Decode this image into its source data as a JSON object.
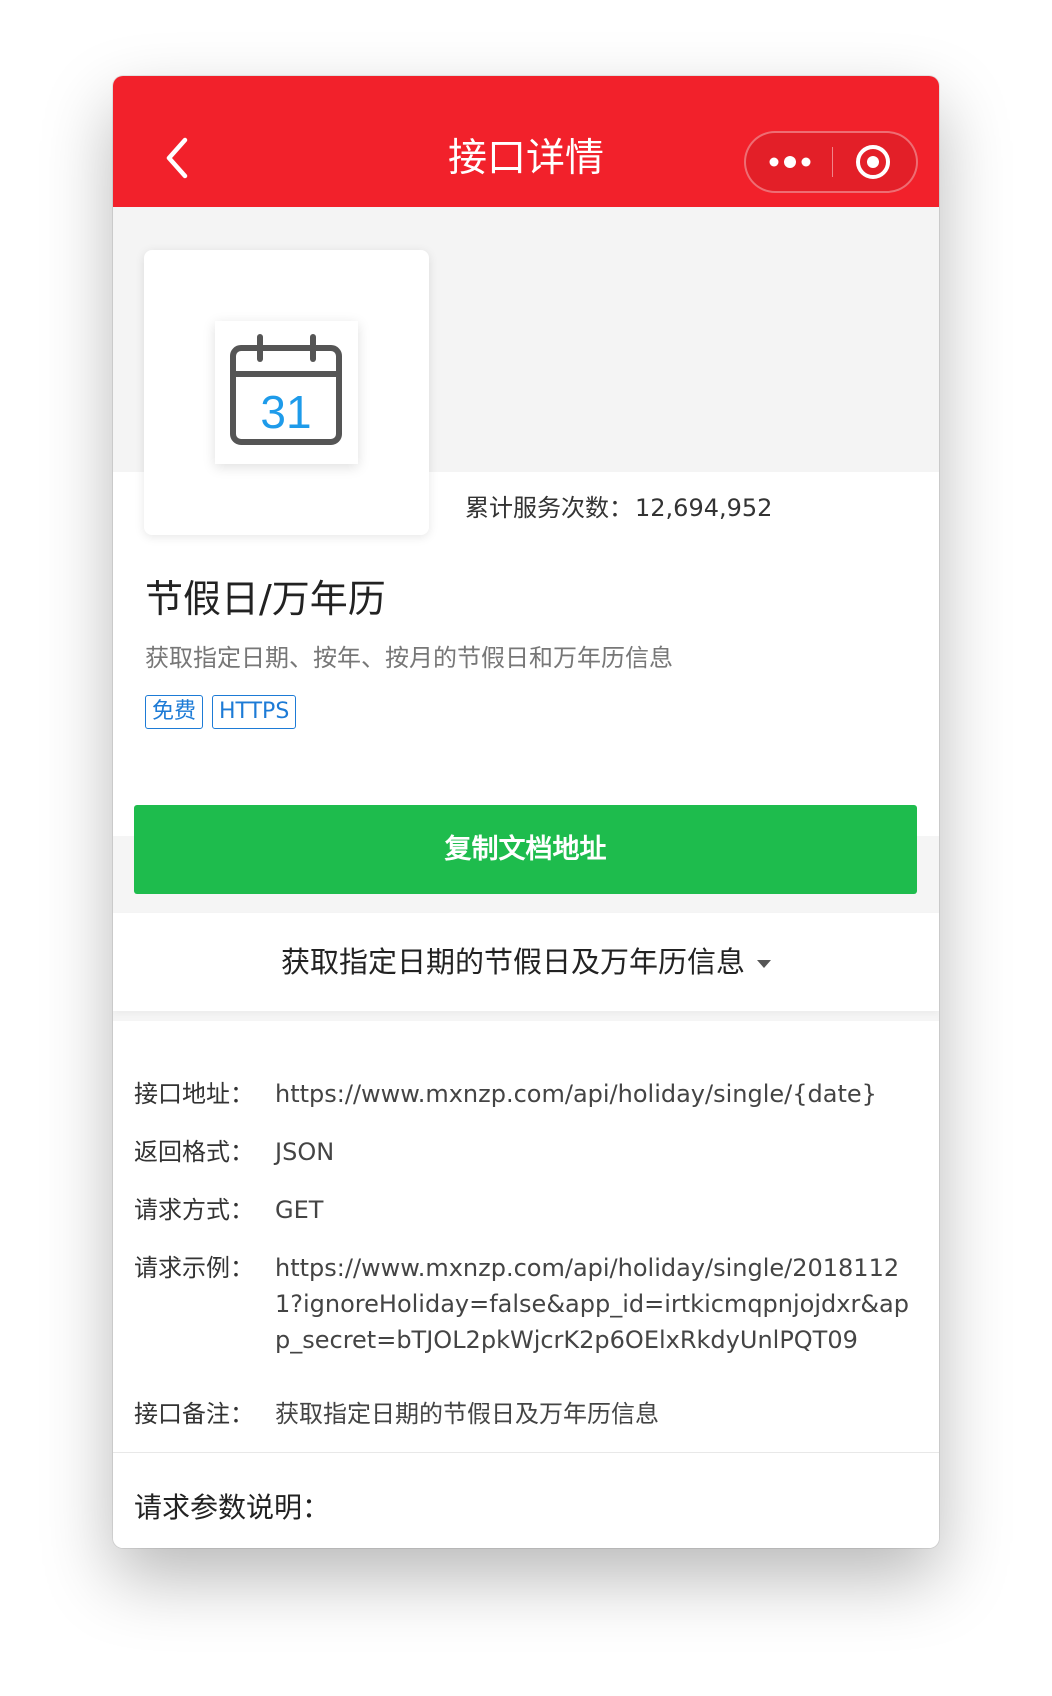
{
  "navbar": {
    "title": "接口详情",
    "colors": {
      "bar": "#f2212b"
    },
    "icons": {
      "back": "chevron-left-icon",
      "more": "more-dots-icon",
      "close": "target-close-icon"
    }
  },
  "api": {
    "icon": "calendar-31-icon",
    "icon_day": "31",
    "counter_label": "累计服务次数：",
    "counter_value": "12,694,952",
    "name": "节假日/万年历",
    "description": "获取指定日期、按年、按月的节假日和万年历信息",
    "tags": [
      "免费",
      "HTTPS"
    ]
  },
  "copy_button": {
    "label": "复制文档地址",
    "color": "#1ebc4d"
  },
  "method_picker": {
    "selected": "获取指定日期的节假日及万年历信息"
  },
  "details": {
    "address_label": "接口地址：",
    "address_value": "https://www.mxnzp.com/api/holiday/single/{date}",
    "format_label": "返回格式：",
    "format_value": "JSON",
    "method_label": "请求方式：",
    "method_value": "GET",
    "example_label": "请求示例：",
    "example_value": "https://www.mxnzp.com/api/holiday/single/20181121?ignoreHoliday=false&app_id=irtkicmqpnjojdxr&app_secret=bTJOL2pkWjcrK2p6OElxRkdyUnlPQT09",
    "note_label": "接口备注：",
    "note_value": "获取指定日期的节假日及万年历信息"
  },
  "params": {
    "title": "请求参数说明："
  }
}
